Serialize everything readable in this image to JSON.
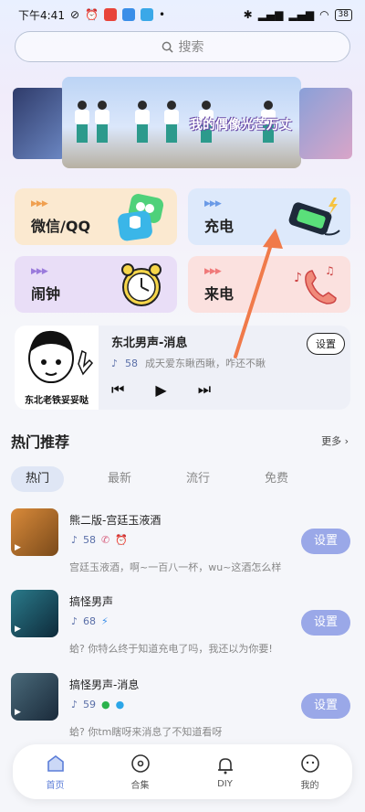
{
  "status": {
    "time": "下午4:41",
    "battery": "38"
  },
  "search": {
    "placeholder": "搜索"
  },
  "banner": {
    "title": "我的偶像光芒万丈"
  },
  "features": [
    {
      "label": "微信/QQ"
    },
    {
      "label": "充电"
    },
    {
      "label": "闹钟"
    },
    {
      "label": "来电"
    }
  ],
  "player": {
    "cover_caption": "东北老铁妥妥哒",
    "title": "东北男声-消息",
    "count": "58",
    "description": "成天爱东瞅西瞅，咋还不瞅",
    "set_label": "设置"
  },
  "hot": {
    "heading": "热门推荐",
    "more": "更多 ›",
    "tabs": [
      "热门",
      "最新",
      "流行",
      "免费"
    ],
    "songs": [
      {
        "title": "熊二版-宫廷玉液酒",
        "count": "58",
        "description": "宫廷玉液酒，啊~一百八一杯，wu~这酒怎么样",
        "button": "设置"
      },
      {
        "title": "搞怪男声",
        "count": "68",
        "description": "蛤? 你特么终于知道充电了吗，我还以为你要!",
        "button": "设置"
      },
      {
        "title": "搞怪男声-消息",
        "count": "59",
        "description": "蛤? 你tm瞎呀来消息了不知道看呀",
        "button": "设置"
      }
    ]
  },
  "nav": [
    {
      "label": "首页"
    },
    {
      "label": "合集"
    },
    {
      "label": "DIY"
    },
    {
      "label": "我的"
    }
  ],
  "colors": {
    "accent": "#5c7ed8",
    "set_button": "#9aa8e8"
  }
}
